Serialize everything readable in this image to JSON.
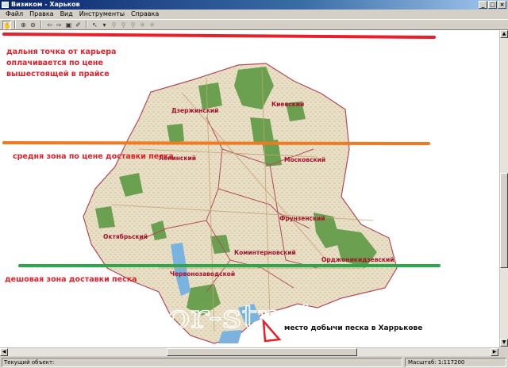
{
  "window": {
    "title": "Визиком - Харьков",
    "controls": [
      "minimize",
      "maximize",
      "close"
    ]
  },
  "menu": [
    "Файл",
    "Правка",
    "Вид",
    "Инструменты",
    "Справка"
  ],
  "toolbar": {
    "tools": [
      {
        "name": "pan-tool",
        "glyph": "✋",
        "active": true
      },
      {
        "name": "zoom-in-tool",
        "glyph": "⊕"
      },
      {
        "name": "zoom-out-tool",
        "glyph": "⊖"
      },
      {
        "name": "back-tool",
        "glyph": "⇦"
      },
      {
        "name": "forward-tool",
        "glyph": "⇨"
      },
      {
        "name": "full-extent-tool",
        "glyph": "▣"
      },
      {
        "name": "measure-tool",
        "glyph": "✐"
      },
      {
        "name": "select-tool",
        "glyph": "↖"
      },
      {
        "name": "select-dropdown",
        "glyph": "▾"
      },
      {
        "name": "route-tool-1",
        "glyph": "⚲"
      },
      {
        "name": "route-tool-2",
        "glyph": "⚲"
      },
      {
        "name": "route-tool-3",
        "glyph": "⚲"
      },
      {
        "name": "route-tool-4",
        "glyph": "✳"
      },
      {
        "name": "route-tool-5",
        "glyph": "✳"
      }
    ]
  },
  "annotations": {
    "far_zone": [
      "дальня точка от карьера",
      "оплачивается по цене",
      "вышестоящей в прайсе"
    ],
    "middle_zone": "средня зона по цене доставки песка",
    "cheap_zone": "дешовая зона доставки песка",
    "quarry": "место добычи песка в Харрькове",
    "colors": {
      "red_line": "#e8202a",
      "orange_line": "#f07a20",
      "green_line": "#2aa84a"
    }
  },
  "districts": {
    "dzerzhinsky": "Дзержинский",
    "kievsky": "Киевский",
    "leninsky": "Ленинский",
    "moskovsky": "Московский",
    "frunzensky": "Фрунзенский",
    "oktyabrsky": "Октябрьский",
    "kominternovsky": "Коминтерновский",
    "ordzhonikidzevsky": "Орджоникидзевский",
    "chervonozavodskoy": "Червонозаводской"
  },
  "watermark": "investor-stroj.com.ua",
  "status": {
    "current_object": "Текущий объект:",
    "scale": "Масштаб: 1:117200"
  }
}
